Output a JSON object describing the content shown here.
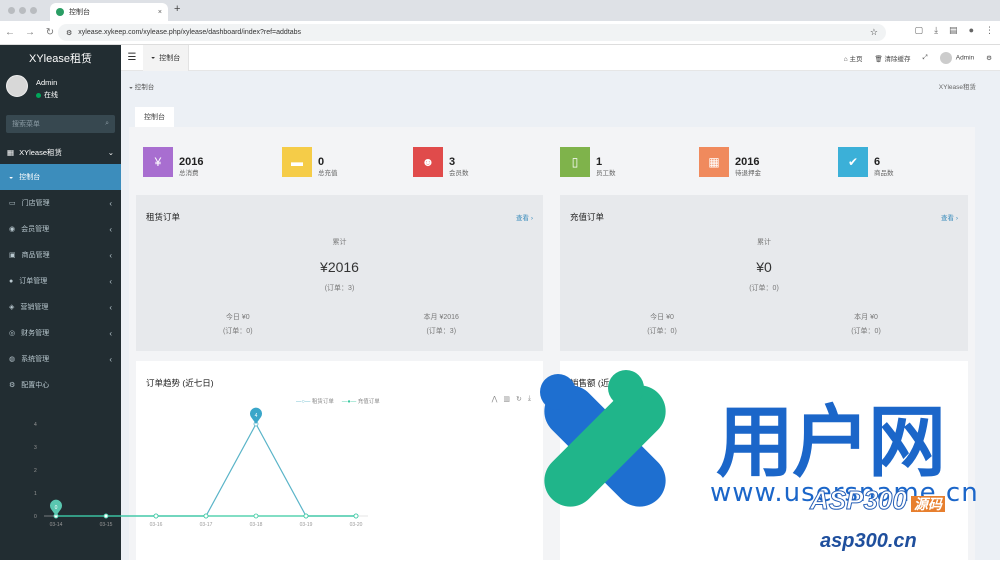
{
  "browser": {
    "tab_title": "控制台",
    "url": "xylease.xykeep.com/xylease.php/xylease/dashboard/index?ref=addtabs",
    "new_tab": "+"
  },
  "sidebar": {
    "logo": "XYlease租赁",
    "user_name": "Admin",
    "user_status": "在线",
    "search_placeholder": "搜索菜单",
    "group_label": "XYlease租赁",
    "items": [
      {
        "label": "控制台",
        "active": true
      },
      {
        "label": "门店管理"
      },
      {
        "label": "会员管理"
      },
      {
        "label": "商品管理"
      },
      {
        "label": "订单管理"
      },
      {
        "label": "营销管理"
      },
      {
        "label": "财务管理"
      },
      {
        "label": "系统管理"
      },
      {
        "label": "配置中心"
      }
    ]
  },
  "topbar": {
    "page_tab": "控制台",
    "home": "主页",
    "clear_cache": "清除缓存",
    "admin": "Admin"
  },
  "main": {
    "breadcrumb": "控制台",
    "breadcrumb_right": "XYlease租赁",
    "inner_tab": "控制台"
  },
  "stats": [
    {
      "value": "2016",
      "label": "总消费",
      "color": "#a86ed0",
      "icon": "yen-icon"
    },
    {
      "value": "0",
      "label": "总充值",
      "color": "#f5cc48",
      "icon": "box-icon"
    },
    {
      "value": "3",
      "label": "会员数",
      "color": "#e04b4b",
      "icon": "users-icon"
    },
    {
      "value": "1",
      "label": "员工数",
      "color": "#7fb34b",
      "icon": "badge-icon"
    },
    {
      "value": "2016",
      "label": "待退押金",
      "color": "#f08a5d",
      "icon": "grid-icon"
    },
    {
      "value": "6",
      "label": "商品数",
      "color": "#3bb0d8",
      "icon": "check-icon"
    }
  ],
  "rent_orders": {
    "title": "租赁订单",
    "more": "查看 ›",
    "total_label": "累计",
    "total_value": "¥2016",
    "total_orders": "(订单：3)",
    "today_label": "今日 ¥0",
    "today_orders": "(订单：0)",
    "month_label": "本月 ¥2016",
    "month_orders": "(订单：3)"
  },
  "recharge_orders": {
    "title": "充值订单",
    "more": "查看 ›",
    "total_label": "累计",
    "total_value": "¥0",
    "total_orders": "(订单：0)",
    "today_label": "今日 ¥0",
    "today_orders": "(订单：0)",
    "month_label": "本月 ¥0",
    "month_orders": "(订单：0)"
  },
  "trend": {
    "title": "订单趋势 (近七日)",
    "legend": [
      "租赁订单",
      "充值订单"
    ],
    "right_title": "销售额 (近"
  },
  "chart_data": {
    "type": "line",
    "categories": [
      "03-14",
      "03-15",
      "03-16",
      "03-17",
      "03-18",
      "03-19",
      "03-20"
    ],
    "series": [
      {
        "name": "租赁订单",
        "values": [
          0,
          0,
          0,
          0,
          4,
          0,
          0
        ]
      },
      {
        "name": "充值订单",
        "values": [
          0,
          0,
          0,
          0,
          0,
          0,
          0
        ]
      }
    ],
    "markers": [
      {
        "category": "03-14",
        "value": 0,
        "label": "0"
      },
      {
        "category": "03-18",
        "value": 4,
        "label": "4"
      }
    ],
    "ylim": [
      0,
      4
    ],
    "yticks": [
      "0",
      "1",
      "2",
      "3",
      "4"
    ],
    "colors": {
      "rent": "#5ab4c8",
      "recharge": "#38c9a0"
    }
  },
  "watermark": {
    "cn": "用户网",
    "site": "www.usersname.cn",
    "asp": "ASP300",
    "asp_tag": "源码",
    "asp_site": "asp300.cn"
  }
}
